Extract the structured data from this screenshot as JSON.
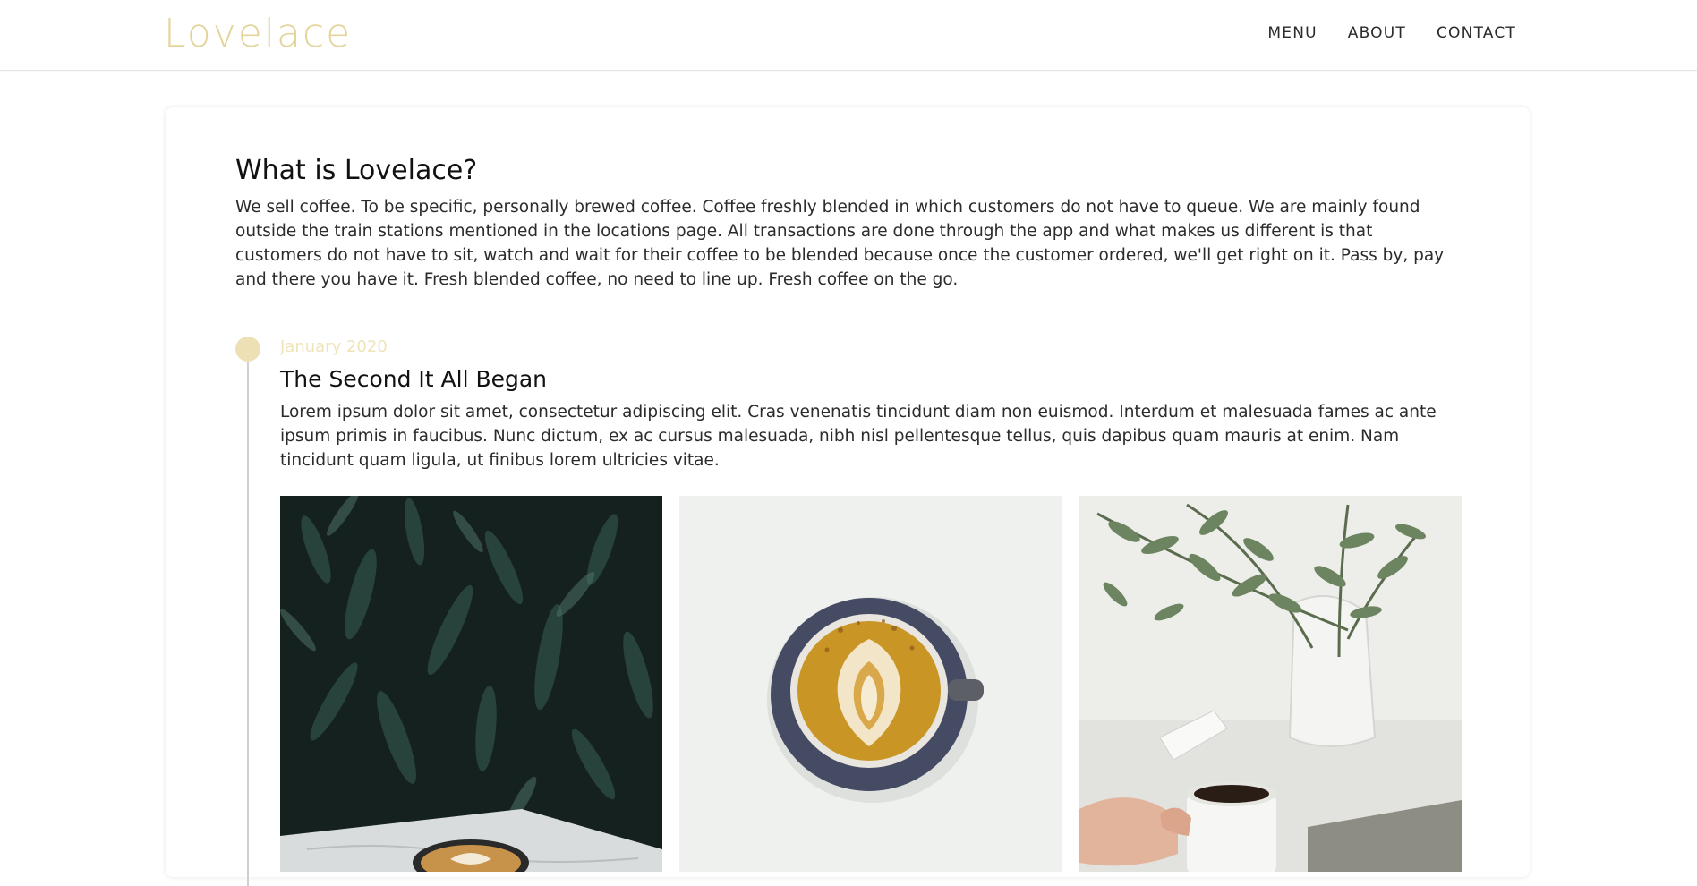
{
  "header": {
    "logo": "Lovelace",
    "nav": [
      {
        "label": "MENU"
      },
      {
        "label": "ABOUT"
      },
      {
        "label": "CONTACT"
      }
    ]
  },
  "intro": {
    "title": "What is Lovelace?",
    "text": "We sell coffee. To be specific, personally brewed coffee. Coffee freshly blended in which customers do not have to queue. We are mainly found outside the train stations mentioned in the locations page. All transactions are done through the app and what makes us different is that customers do not have to sit, watch and wait for their coffee to be blended because once the customer ordered, we'll get right on it. Pass by, pay and there you have it. Fresh blended coffee, no need to line up. Fresh coffee on the go."
  },
  "timeline": {
    "entries": [
      {
        "date": "January 2020",
        "title": "The Second It All Began",
        "text": "Lorem ipsum dolor sit amet, consectetur adipiscing elit. Cras venenatis tincidunt diam non euismod. Interdum et malesuada fames ac ante ipsum primis in faucibus. Nunc dictum, ex ac cursus malesuada, nibh nisl pellentesque tellus, quis dapibus quam mauris at enim. Nam tincidunt quam ligula, ut finibus lorem ultricies vitae."
      }
    ]
  },
  "colors": {
    "brand": "#e3d49a",
    "timeline_dot": "#ece0b4",
    "date_text": "#efe3b9"
  },
  "photos": [
    {
      "icon": "latte-with-fern-photo"
    },
    {
      "icon": "latte-art-cup-photo"
    },
    {
      "icon": "coffee-mug-with-plant-photo"
    }
  ]
}
